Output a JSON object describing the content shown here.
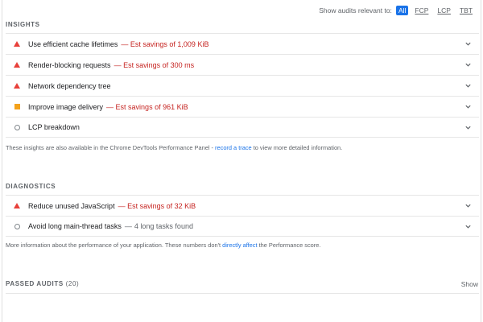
{
  "relevant": {
    "label": "Show audits relevant to:",
    "chips": [
      {
        "label": "All",
        "active": true
      },
      {
        "label": "FCP",
        "active": false
      },
      {
        "label": "LCP",
        "active": false
      },
      {
        "label": "TBT",
        "active": false
      }
    ]
  },
  "insights": {
    "title": "INSIGHTS",
    "items": [
      {
        "icon": "fail-triangle-icon",
        "title": "Use efficient cache lifetimes",
        "savings": "Est savings of 1,009 KiB"
      },
      {
        "icon": "fail-triangle-icon",
        "title": "Render-blocking requests",
        "savings": "Est savings of 300 ms"
      },
      {
        "icon": "fail-triangle-icon",
        "title": "Network dependency tree",
        "savings": ""
      },
      {
        "icon": "average-square-icon",
        "title": "Improve image delivery",
        "savings": "Est savings of 961 KiB"
      },
      {
        "icon": "info-circle-icon",
        "title": "LCP breakdown",
        "savings": ""
      }
    ],
    "note_prefix": "These insights are also available in the Chrome DevTools Performance Panel - ",
    "note_link": "record a trace",
    "note_suffix": " to view more detailed information."
  },
  "diagnostics": {
    "title": "DIAGNOSTICS",
    "items": [
      {
        "icon": "fail-triangle-icon",
        "title": "Reduce unused JavaScript",
        "savings": "Est savings of 32 KiB",
        "detail": ""
      },
      {
        "icon": "info-circle-icon",
        "title": "Avoid long main-thread tasks",
        "savings": "",
        "detail": "4 long tasks found"
      }
    ],
    "note_prefix": "More information about the performance of your application. These numbers don't ",
    "note_link": "directly affect",
    "note_suffix": " the Performance score."
  },
  "passed": {
    "title": "PASSED AUDITS",
    "count": "(20)",
    "show_label": "Show"
  }
}
